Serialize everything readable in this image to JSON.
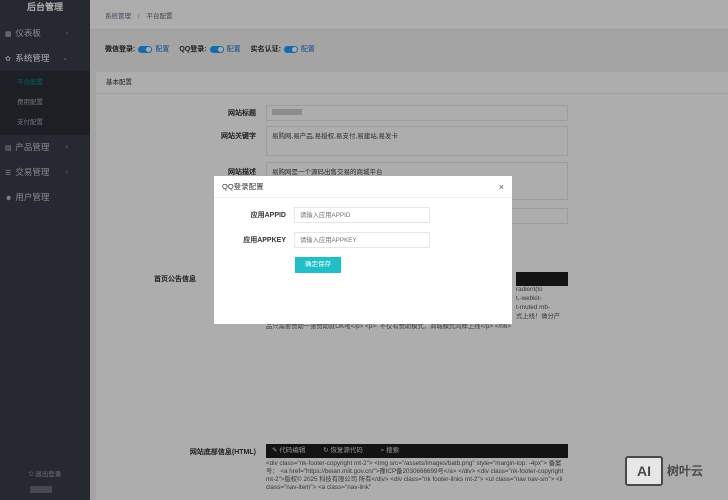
{
  "sidebar": {
    "brand": "后台管理",
    "items": [
      {
        "label": "仪表板",
        "icon": "dashboard-icon"
      },
      {
        "label": "系统管理",
        "icon": "gear-icon"
      },
      {
        "label": "产品管理",
        "icon": "grid-icon"
      },
      {
        "label": "交易管理",
        "icon": "list-icon"
      },
      {
        "label": "用户管理",
        "icon": "user-icon"
      }
    ],
    "subitems": [
      "平台配置",
      "费用配置",
      "支付配置"
    ],
    "logout": "退出登录"
  },
  "breadcrumb": {
    "parent": "系统管理",
    "current": "平台配置"
  },
  "switches": [
    {
      "label": "微信登录:",
      "action": "配置"
    },
    {
      "label": "QQ登录:",
      "action": "配置"
    },
    {
      "label": "实名认证:",
      "action": "配置"
    }
  ],
  "card": {
    "title": "基本配置",
    "fields": {
      "site_title_label": "网站标题",
      "keywords_label": "网站关键字",
      "keywords_value": "易购网,易产品,易授权,易支付,易建站,易发卡",
      "desc_label": "网站描述",
      "desc_value": "易购网是一个源码出售交易的商城平台",
      "notice_label": "首页公告信息",
      "footer_label": "网站底部信息(HTML)"
    },
    "notice_snippets": [
      "radient(to",
      "t,-webkit-",
      "t-muted mb-",
      "式上线！做分产",
      "品只需要赞助一张赞助就OK啦</p> <p>· 不仅有赞助模式，商城模式同样上线</p> </h6>"
    ],
    "editor_tools": {
      "code_edit": "代码编辑",
      "restore": "恢复源代码",
      "search": "搜索"
    },
    "footer_code": "<div class=\"nk-footer-copyright mt-2\"> <img src=\"/assets/images/batb.png\" style=\"margin-top: -4px\"> 备案号： <a href=\"https://beian.miit.gov.cn/\">豫ICP备2030666699号</a> </div> <div class=\"nk-footer-copyright mt-2\">版权© 2025 科技有限公司 所有</div> <div class=\"nk footer-links mt-2\"> <ul class=\"nav nav-sm\"> <li class=\"nav-item\"> <a class=\"nav-link\""
  },
  "modal": {
    "title": "QQ登录配置",
    "close": "×",
    "appid_label": "应用APPID",
    "appid_placeholder": "请输入应用APPID",
    "appkey_label": "应用APPKEY",
    "appkey_placeholder": "请输入应用APPKEY",
    "submit": "确定保存"
  },
  "watermark": {
    "box": "AI",
    "text": "树叶云"
  },
  "colors": {
    "sidebar": "#393d49",
    "accent": "#009688",
    "toggle": "#1e9fff",
    "button": "#1ebfc7"
  }
}
